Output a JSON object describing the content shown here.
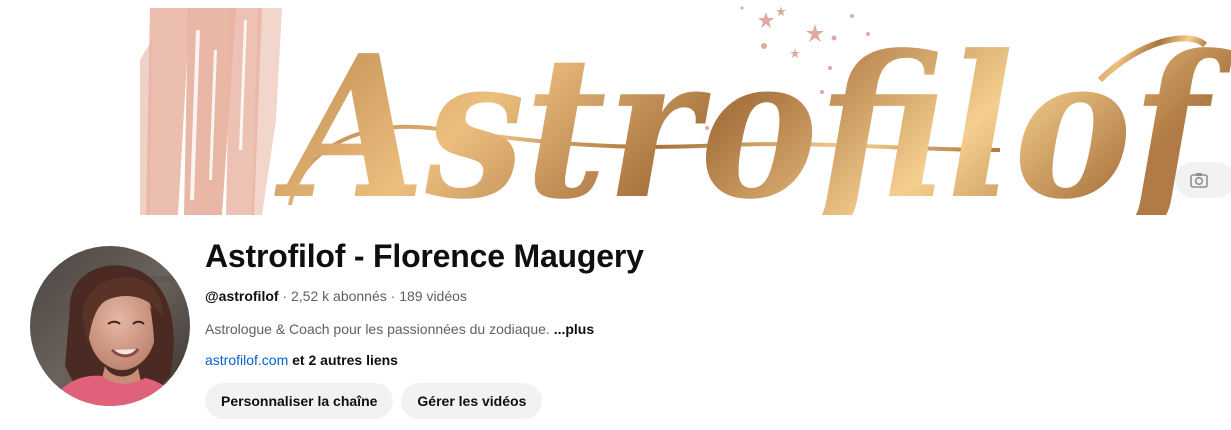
{
  "banner": {
    "wordmark": "Astrofilof",
    "colors": {
      "gold_light": "#f5cf8f",
      "gold_dark": "#a8733f",
      "brush": "#e8b3a1",
      "stars": "#dea9a0"
    }
  },
  "channel": {
    "name": "Astrofilof - Florence Maugery",
    "handle": "@astrofilof",
    "subscribers": "2,52 k abonnés",
    "videos": "189 vidéos",
    "separator": " · ",
    "description": "Astrologue & Coach pour les passionnées du zodiaque.",
    "more_label": "...plus",
    "link": "astrofilof.com",
    "other_links": "et 2 autres liens"
  },
  "actions": {
    "customize": "Personnaliser la chaîne",
    "manage": "Gérer les vidéos"
  },
  "icons": {
    "banner_edit": "camera-icon"
  }
}
